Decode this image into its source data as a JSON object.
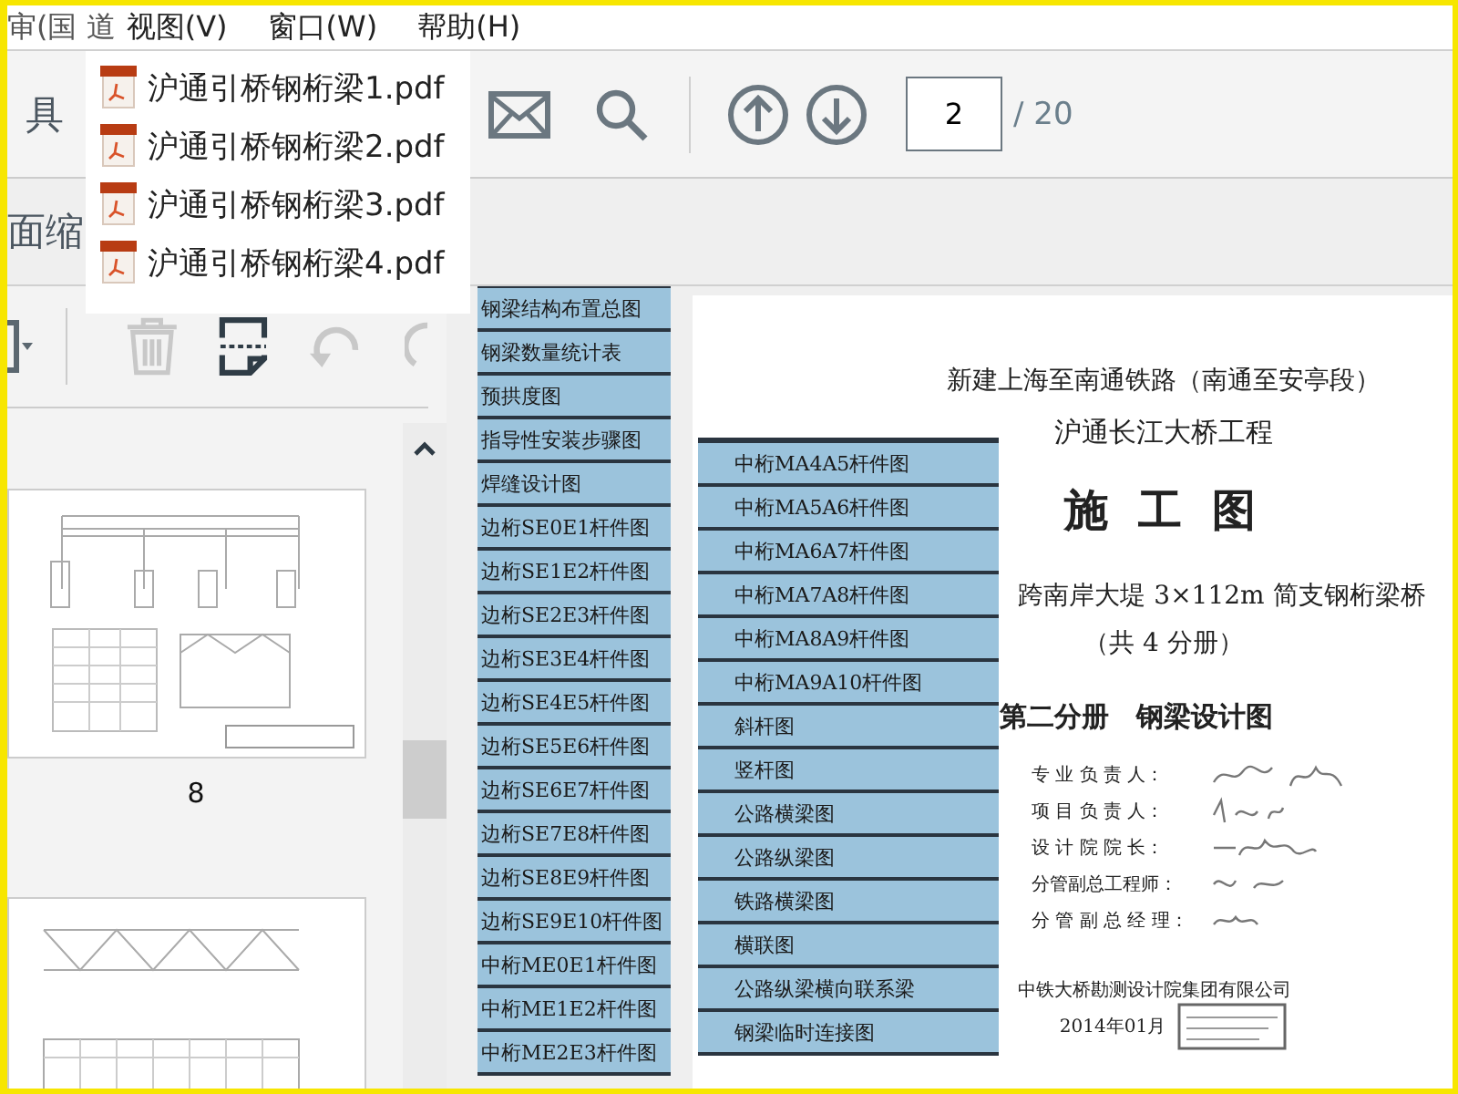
{
  "menu_bar": {
    "items": [
      {
        "label": "审(国 道"
      },
      {
        "label": "视图(V)"
      },
      {
        "label": "窗口(W)"
      },
      {
        "label": "帮助(H)"
      }
    ]
  },
  "toolbar": {
    "tools_label": "具",
    "page_input": {
      "value": "2"
    },
    "page_total": "/ 20"
  },
  "recent_files": [
    {
      "label": "沪通引桥钢桁梁1.pdf"
    },
    {
      "label": "沪通引桥钢桁梁2.pdf"
    },
    {
      "label": "沪通引桥钢桁梁3.pdf"
    },
    {
      "label": "沪通引桥钢桁梁4.pdf"
    }
  ],
  "sidebar": {
    "title": "面缩",
    "tools": [
      {
        "kind": "trash",
        "disabled": true
      },
      {
        "kind": "extract",
        "disabled": false
      },
      {
        "kind": "rotate_left",
        "disabled": true
      },
      {
        "kind": "rotate_right",
        "disabled": true
      }
    ],
    "thumbnails": [
      {
        "label": "8"
      }
    ]
  },
  "document": {
    "left_strip": [
      "钢梁结构布置总图",
      "钢梁数量统计表",
      "预拱度图",
      "指导性安装步骤图",
      "焊缝设计图",
      "边桁SE0E1杆件图",
      "边桁SE1E2杆件图",
      "边桁SE2E3杆件图",
      "边桁SE3E4杆件图",
      "边桁SE4E5杆件图",
      "边桁SE5E6杆件图",
      "边桁SE6E7杆件图",
      "边桁SE7E8杆件图",
      "边桁SE8E9杆件图",
      "边桁SE9E10杆件图",
      "中桁ME0E1杆件图",
      "中桁ME1E2杆件图",
      "中桁ME2E3杆件图"
    ],
    "middle_strip": [
      "中桁MA4A5杆件图",
      "中桁MA5A6杆件图",
      "中桁MA6A7杆件图",
      "中桁MA7A8杆件图",
      "中桁MA8A9杆件图",
      "中桁MA9A10杆件图",
      "斜杆图",
      "竖杆图",
      "公路横梁图",
      "公路纵梁图",
      "铁路横梁图",
      "横联图",
      "公路纵梁横向联系梁",
      "钢梁临时连接图"
    ],
    "title_lines": [
      "新建上海至南通铁路（南通至安亭段）",
      "沪通长江大桥工程"
    ],
    "drawing_type": "施 工 图",
    "bridge_name": "跨南岸大堤 3×112m 简支钢桁梁桥",
    "volume_count": "（共 4 分册）",
    "volume_title": "第二分册　钢梁设计图",
    "signatories": [
      "专 业 负 责 人：",
      "项 目 负 责 人：",
      "设 计 院 院 长：",
      "分管副总工程师：",
      "分 管 副 总 经 理："
    ],
    "company": "中铁大桥勘测设计院集团有限公司",
    "date": "2014年01月"
  }
}
